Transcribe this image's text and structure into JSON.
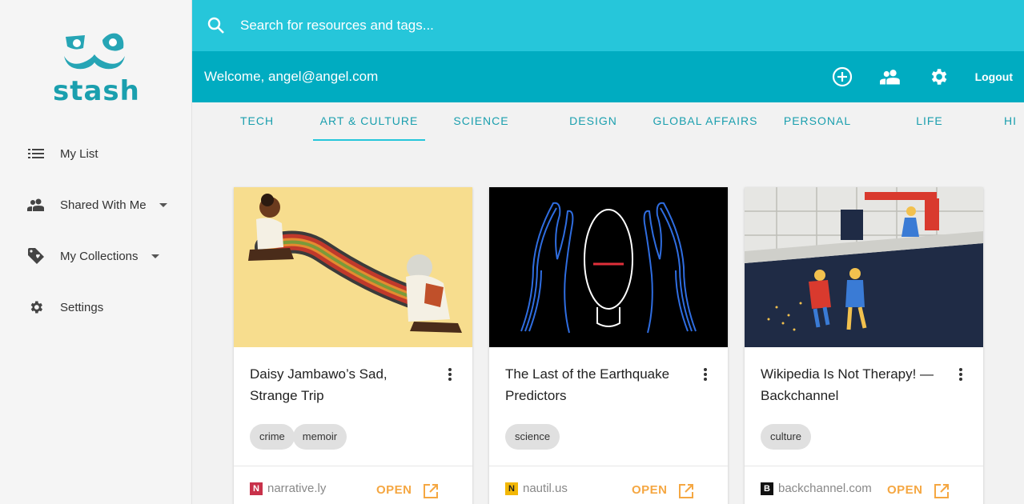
{
  "app": {
    "name": "stash"
  },
  "colors": {
    "accent": "#26c6da",
    "header": "#00acc1",
    "open": "#f5a742",
    "brand": "#1a9fae"
  },
  "sidebar": {
    "items": [
      {
        "label": "My List",
        "icon": "list-icon"
      },
      {
        "label": "Shared With Me",
        "icon": "people-icon",
        "expandable": true
      },
      {
        "label": "My Collections",
        "icon": "tag-icon",
        "expandable": true
      },
      {
        "label": "Settings",
        "icon": "gear-icon"
      }
    ]
  },
  "search": {
    "placeholder": "Search for resources and tags..."
  },
  "header": {
    "welcome": "Welcome, angel@angel.com",
    "logout": "Logout"
  },
  "tabs": [
    {
      "label": "TECH"
    },
    {
      "label": "ART & CULTURE",
      "active": true
    },
    {
      "label": "SCIENCE"
    },
    {
      "label": "DESIGN"
    },
    {
      "label": "GLOBAL AFFAIRS"
    },
    {
      "label": "PERSONAL"
    },
    {
      "label": "LIFE"
    },
    {
      "label": "HI"
    }
  ],
  "cards": [
    {
      "title": "Daisy Jambawo’s Sad, Strange Trip",
      "tags": [
        "crime",
        "memoir"
      ],
      "source": "narrative.ly",
      "open": "OPEN"
    },
    {
      "title": "The Last of the Earthquake Predictors",
      "tags": [
        "science"
      ],
      "source": "nautil.us",
      "open": "OPEN"
    },
    {
      "title": "Wikipedia Is Not Therapy! — Backchannel",
      "tags": [
        "culture"
      ],
      "source": "backchannel.com",
      "open": "OPEN"
    }
  ]
}
